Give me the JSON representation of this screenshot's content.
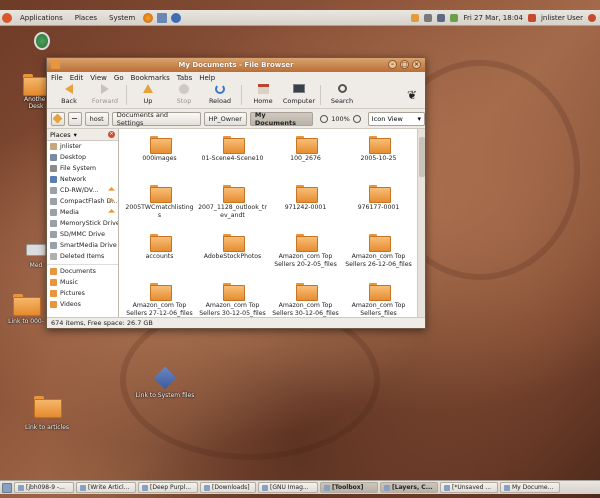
{
  "top_panel": {
    "menus": [
      "Applications",
      "Places",
      "System"
    ],
    "clock": "Fri 27 Mar, 18:04",
    "user": "jnlister User"
  },
  "desktop": {
    "icons": [
      {
        "label": "Another Desk"
      },
      {
        "label": "Med"
      },
      {
        "label": "Link to 000-"
      },
      {
        "label": "Link to System files"
      },
      {
        "label": "Link to articles"
      }
    ]
  },
  "window": {
    "title": "My Documents - File Browser",
    "menus": [
      "File",
      "Edit",
      "View",
      "Go",
      "Bookmarks",
      "Tabs",
      "Help"
    ],
    "toolbar": {
      "back": "Back",
      "forward": "Forward",
      "up": "Up",
      "stop": "Stop",
      "reload": "Reload",
      "home": "Home",
      "computer": "Computer",
      "search": "Search"
    },
    "location": {
      "crumbs": [
        "host",
        "Documents and Settings",
        "HP_Owner",
        "My Documents"
      ],
      "zoom": "100%",
      "view_mode": "Icon View"
    },
    "sidebar": {
      "header": "Places",
      "items": [
        {
          "label": "jnlister",
          "color": "#c9a57b",
          "eject": false
        },
        {
          "label": "Desktop",
          "color": "#7a8aa0",
          "eject": false
        },
        {
          "label": "File System",
          "color": "#8a8a8a",
          "eject": false
        },
        {
          "label": "Network",
          "color": "#5b7fb4",
          "eject": false
        },
        {
          "label": "CD-RW/DV...",
          "color": "#9aa0a8",
          "eject": true
        },
        {
          "label": "CompactFlash D...",
          "color": "#9aa0a8",
          "eject": true
        },
        {
          "label": "Media",
          "color": "#9aa0a8",
          "eject": true
        },
        {
          "label": "MemoryStick Drive",
          "color": "#9aa0a8",
          "eject": false
        },
        {
          "label": "SD/MMC Drive",
          "color": "#9aa0a8",
          "eject": false
        },
        {
          "label": "SmartMedia Drive",
          "color": "#9aa0a8",
          "eject": false
        },
        {
          "label": "Deleted Items",
          "color": "#b0b0b0",
          "eject": false
        }
      ],
      "bookmarks": [
        {
          "label": "Documents",
          "color": "#e8953e"
        },
        {
          "label": "Music",
          "color": "#e8953e"
        },
        {
          "label": "Pictures",
          "color": "#e8953e"
        },
        {
          "label": "Videos",
          "color": "#e8953e"
        }
      ]
    },
    "files": [
      "000images",
      "01-Scene4-Scene10",
      "100_2676",
      "2005-10-25",
      "2005TWCmatchlistings",
      "2007_1128_outlook_trev_andt",
      "971242-0001",
      "976177-0001",
      "accounts",
      "AdobeStockPhotos",
      "Amazon_com Top Sellers 20-2-05_files",
      "Amazon_com Top Sellers 26-12-06_files",
      "Amazon_com Top Sellers 27-12-06_files",
      "Amazon_com Top Sellers 30-12-05_files",
      "Amazon_com Top Sellers 30-12-06_files",
      "Amazon_com Top Sellers_files"
    ],
    "status": "674 items, Free space: 26.7 GB"
  },
  "taskbar": {
    "tasks": [
      {
        "label": "[jbh098-9 -...",
        "active": false
      },
      {
        "label": "[Write Articl...",
        "active": false
      },
      {
        "label": "[Deep Purpl...",
        "active": false
      },
      {
        "label": "[Downloads]",
        "active": false
      },
      {
        "label": "[GNU Imag...",
        "active": false
      },
      {
        "label": "[Toolbox]",
        "active": true
      },
      {
        "label": "[Layers, C...",
        "active": true
      },
      {
        "label": "[*Unsaved ...",
        "active": false
      },
      {
        "label": "My Docume...",
        "active": false
      }
    ]
  }
}
